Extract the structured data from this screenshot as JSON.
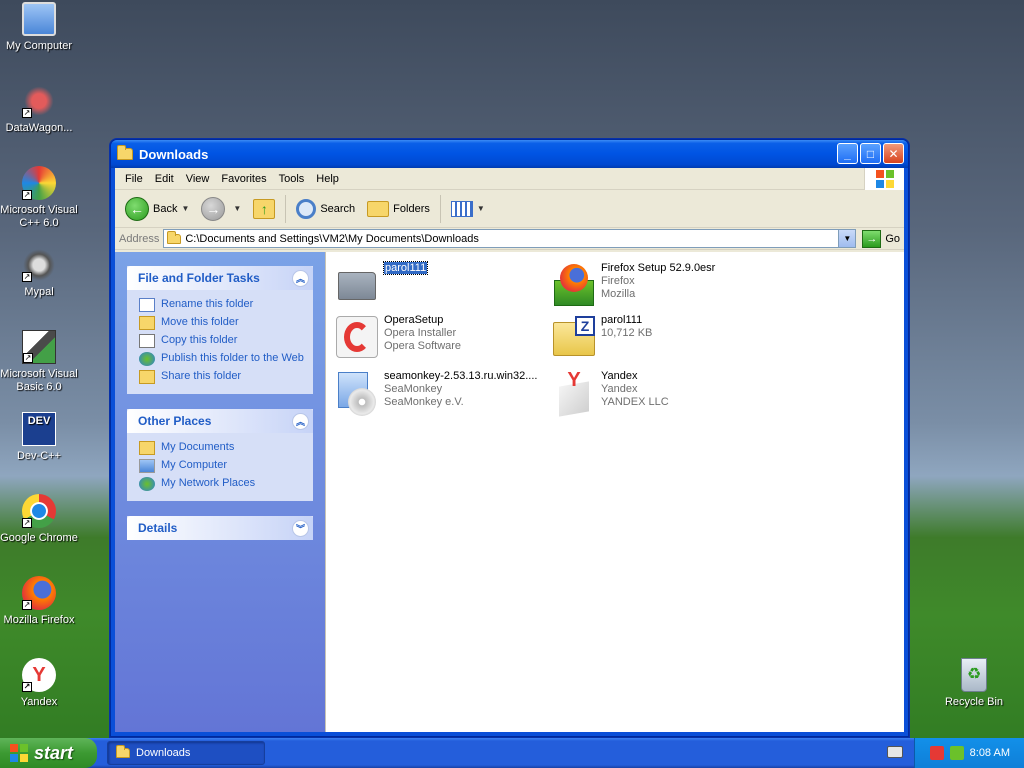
{
  "desktop": {
    "icons": [
      {
        "label": "My Computer"
      },
      {
        "label": "DataWagon..."
      },
      {
        "label": "Microsoft Visual C++ 6.0"
      },
      {
        "label": "Mypal"
      },
      {
        "label": "Microsoft Visual Basic 6.0"
      },
      {
        "label": "Dev-C++"
      },
      {
        "label": "Google Chrome"
      },
      {
        "label": "Mozilla Firefox"
      },
      {
        "label": "Yandex"
      },
      {
        "label": "Recycle Bin"
      }
    ]
  },
  "window": {
    "title": "Downloads",
    "menu": [
      "File",
      "Edit",
      "View",
      "Favorites",
      "Tools",
      "Help"
    ],
    "toolbar": {
      "back": "Back",
      "search": "Search",
      "folders": "Folders"
    },
    "address": {
      "label": "Address",
      "path": "C:\\Documents and Settings\\VM2\\My Documents\\Downloads",
      "go": "Go"
    }
  },
  "sidepanel": {
    "tasks": {
      "title": "File and Folder Tasks",
      "items": [
        "Rename this folder",
        "Move this folder",
        "Copy this folder",
        "Publish this folder to the Web",
        "Share this folder"
      ]
    },
    "places": {
      "title": "Other Places",
      "items": [
        "My Documents",
        "My Computer",
        "My Network Places"
      ]
    },
    "details": {
      "title": "Details"
    }
  },
  "files": [
    {
      "name": "parol111",
      "line2": "",
      "line3": ""
    },
    {
      "name": "Firefox Setup 52.9.0esr",
      "line2": "Firefox",
      "line3": "Mozilla"
    },
    {
      "name": "OperaSetup",
      "line2": "Opera Installer",
      "line3": "Opera Software"
    },
    {
      "name": "parol111",
      "line2": "10,712 KB",
      "line3": ""
    },
    {
      "name": "seamonkey-2.53.13.ru.win32....",
      "line2": "SeaMonkey",
      "line3": "SeaMonkey e.V."
    },
    {
      "name": "Yandex",
      "line2": "Yandex",
      "line3": "YANDEX LLC"
    }
  ],
  "taskbar": {
    "start": "start",
    "task": "Downloads",
    "clock": "8:08 AM"
  }
}
